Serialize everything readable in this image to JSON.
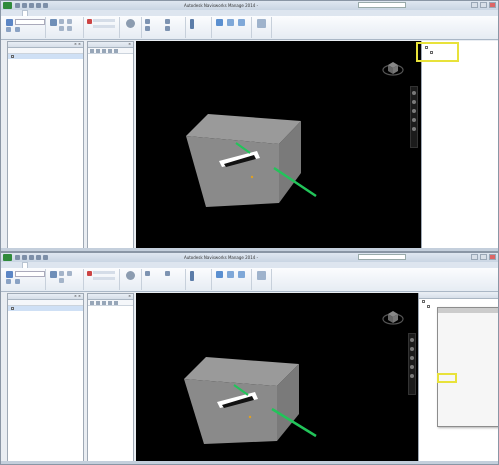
{
  "app": {
    "doc_title": "Autodesk Navisworks Manage 2014 - ",
    "search_placeholder": "",
    "tabs": [
      "",
      "",
      "",
      "",
      "",
      "",
      "",
      "",
      ""
    ]
  },
  "left_panel": {
    "title": "",
    "tree_item": ""
  },
  "middle_panel": {
    "title": ""
  },
  "right_panel": {
    "title": ""
  },
  "context_menu": {
    "items": [
      "",
      "",
      "",
      "",
      "",
      "",
      "",
      "",
      "",
      "",
      "",
      "",
      "",
      "",
      "",
      "",
      "",
      "",
      "",
      "",
      ""
    ],
    "highlighted_index": 12
  },
  "colors": {
    "viewport_bg": "#000000",
    "box_face": "#8a8a8a",
    "green_arrow": "#22c45a",
    "highlight": "#e8e23a"
  }
}
